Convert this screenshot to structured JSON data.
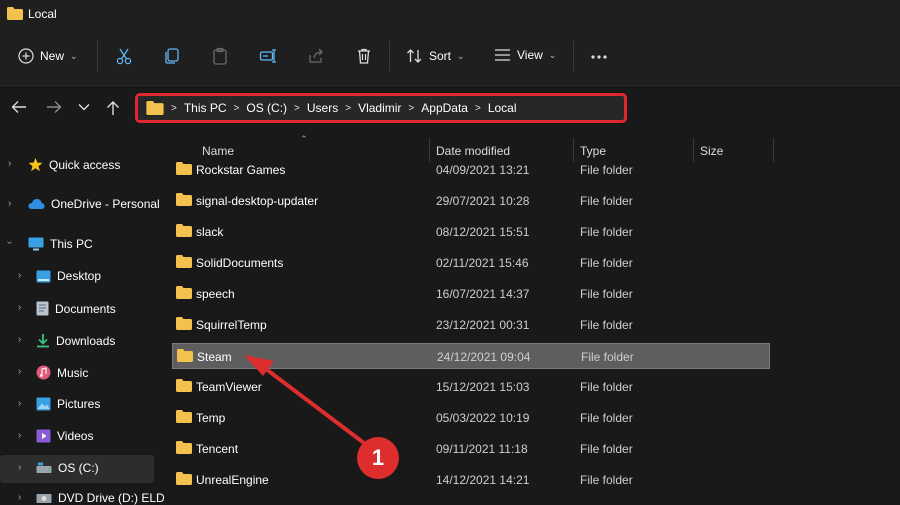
{
  "window": {
    "title": "Local",
    "folder_icon": "folder-icon"
  },
  "toolbar": {
    "new_label": "New",
    "sort_label": "Sort",
    "view_label": "View",
    "icons": [
      "plus-circle-icon",
      "cut-icon",
      "copy-icon",
      "paste-icon",
      "rename-icon",
      "share-icon",
      "delete-icon",
      "sort-icon",
      "view-icon",
      "more-icon"
    ]
  },
  "address": {
    "crumbs": [
      "This PC",
      "OS (C:)",
      "Users",
      "Vladimir",
      "AppData",
      "Local"
    ],
    "highlight_color": "#e0262f"
  },
  "sidebar": {
    "items": [
      {
        "label": "Quick access",
        "icon": "star-icon"
      },
      {
        "label": "OneDrive - Personal",
        "icon": "cloud-icon"
      },
      {
        "label": "This PC",
        "icon": "monitor-icon"
      },
      {
        "label": "Desktop",
        "icon": "desktop-icon"
      },
      {
        "label": "Documents",
        "icon": "documents-icon"
      },
      {
        "label": "Downloads",
        "icon": "download-icon"
      },
      {
        "label": "Music",
        "icon": "music-icon"
      },
      {
        "label": "Pictures",
        "icon": "pictures-icon"
      },
      {
        "label": "Videos",
        "icon": "videos-icon"
      },
      {
        "label": "OS (C:)",
        "icon": "drive-icon"
      },
      {
        "label": "DVD Drive (D:) ELD",
        "icon": "dvd-icon"
      }
    ]
  },
  "columns": {
    "name": "Name",
    "date": "Date modified",
    "type": "Type",
    "size": "Size"
  },
  "files": [
    {
      "name": "Rockstar Games",
      "date": "04/09/2021 13:21",
      "type": "File folder"
    },
    {
      "name": "signal-desktop-updater",
      "date": "29/07/2021 10:28",
      "type": "File folder"
    },
    {
      "name": "slack",
      "date": "08/12/2021 15:51",
      "type": "File folder"
    },
    {
      "name": "SolidDocuments",
      "date": "02/11/2021 15:46",
      "type": "File folder"
    },
    {
      "name": "speech",
      "date": "16/07/2021 14:37",
      "type": "File folder"
    },
    {
      "name": "SquirrelTemp",
      "date": "23/12/2021 00:31",
      "type": "File folder"
    },
    {
      "name": "Steam",
      "date": "24/12/2021 09:04",
      "type": "File folder",
      "selected": true
    },
    {
      "name": "TeamViewer",
      "date": "15/12/2021 15:03",
      "type": "File folder"
    },
    {
      "name": "Temp",
      "date": "05/03/2022 10:19",
      "type": "File folder"
    },
    {
      "name": "Tencent",
      "date": "09/11/2021 11:18",
      "type": "File folder"
    },
    {
      "name": "UnrealEngine",
      "date": "14/12/2021 14:21",
      "type": "File folder"
    }
  ],
  "annotation": {
    "number": "1",
    "color": "#dd2d2d"
  },
  "colors": {
    "folder": "#f2c14e",
    "selection": "#5e5e5e",
    "background": "#191919"
  }
}
